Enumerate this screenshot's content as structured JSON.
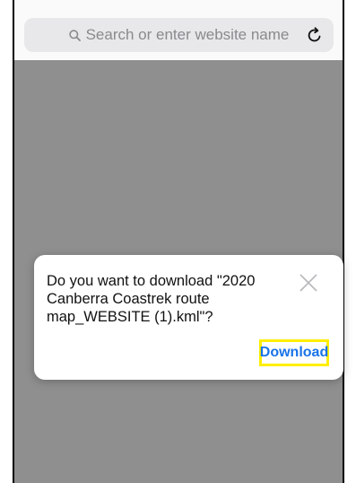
{
  "browser": {
    "search_placeholder": "Search or enter website name",
    "search_icon": "search-icon",
    "reload_icon": "reload-icon"
  },
  "dialog": {
    "line1": "Do you want to download \"2020",
    "line2": "Canberra Coastrek route",
    "line3": "map_WEBSITE (1).kml\"?",
    "close_icon": "close-icon",
    "download_label": "Download",
    "accent_color": "#1a73e8",
    "highlight_color": "#ffee00"
  }
}
